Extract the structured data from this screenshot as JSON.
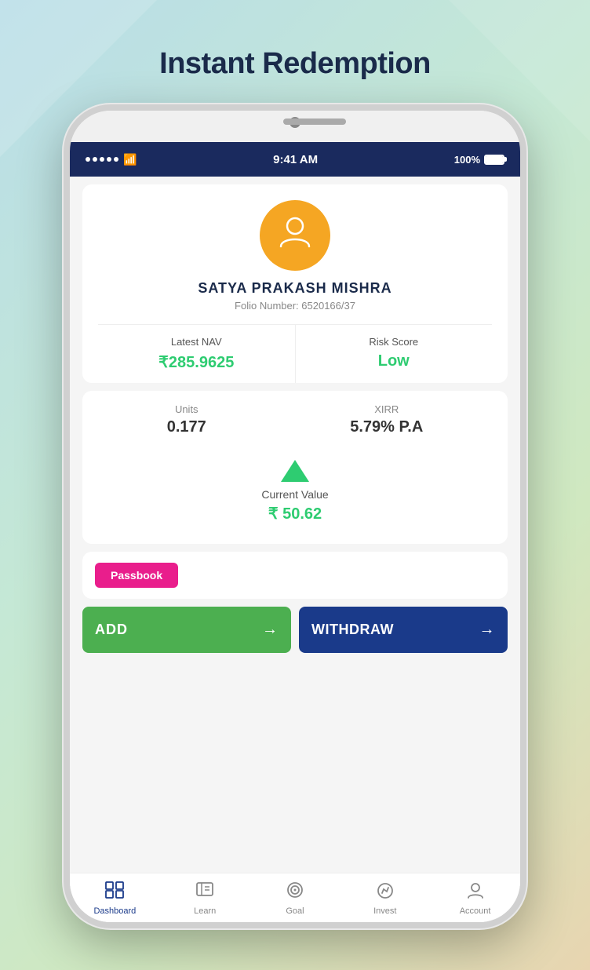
{
  "page": {
    "title": "Instant Redemption",
    "background": "gradient-light"
  },
  "statusBar": {
    "time": "9:41 AM",
    "battery": "100%",
    "signal": "●●●●●",
    "wifi": "wifi"
  },
  "profile": {
    "name": "SATYA PRAKASH MISHRA",
    "folio_label": "Folio Number: 6520166/37",
    "folio_number": "6520166/37"
  },
  "stats": {
    "nav_label": "Latest NAV",
    "nav_value": "₹285.9625",
    "risk_label": "Risk Score",
    "risk_value": "Low",
    "units_label": "Units",
    "units_value": "0.177",
    "xirr_label": "XIRR",
    "xirr_value": "5.79% P.A",
    "current_value_label": "Current Value",
    "current_value": "₹ 50.62"
  },
  "passbook": {
    "tab_label": "Passbook",
    "tab_text": "Passbook"
  },
  "buttons": {
    "add_label": "ADD",
    "withdraw_label": "WITHDRAW",
    "arrow": "→"
  },
  "bottomNav": {
    "items": [
      {
        "id": "dashboard",
        "label": "Dashboard",
        "icon": "dashboard",
        "active": true
      },
      {
        "id": "learn",
        "label": "Learn",
        "icon": "learn",
        "active": false
      },
      {
        "id": "goal",
        "label": "Goal",
        "icon": "goal",
        "active": false
      },
      {
        "id": "invest",
        "label": "Invest",
        "icon": "invest",
        "active": false
      },
      {
        "id": "account",
        "label": "Account",
        "icon": "account",
        "active": false
      }
    ]
  }
}
